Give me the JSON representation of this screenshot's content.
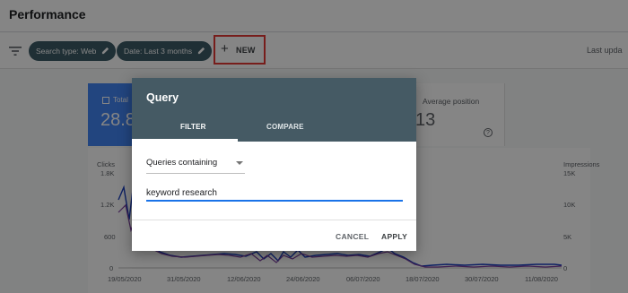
{
  "header": {
    "title": "Performance"
  },
  "filterbar": {
    "filter_icon": "filter-list-icon",
    "chips": [
      {
        "label": "Search type: Web",
        "icon": "pencil-icon"
      },
      {
        "label": "Date: Last 3 months",
        "icon": "pencil-icon"
      }
    ],
    "new_button": {
      "icon": "plus-icon",
      "label": "NEW"
    },
    "last_update": "Last upda"
  },
  "cards": {
    "total": {
      "label": "Total",
      "value": "28.8"
    },
    "position": {
      "label": "Average position",
      "value": "13",
      "help_icon": "help-icon"
    }
  },
  "chart": {
    "left_axis_title": "Clicks",
    "right_axis_title": "Impressions",
    "left_ticks": [
      "1.8K",
      "1.2K",
      "600",
      "0"
    ],
    "right_ticks": [
      "15K",
      "10K",
      "5K",
      "0"
    ],
    "x_ticks": [
      "19/05/2020",
      "31/05/2020",
      "12/06/2020",
      "24/06/2020",
      "06/07/2020",
      "18/07/2020",
      "30/07/2020",
      "11/08/2020"
    ],
    "colors": {
      "clicks": "#1a3fbf",
      "impressions": "#7b3fa0"
    }
  },
  "dialog": {
    "title": "Query",
    "tabs": [
      {
        "label": "FILTER"
      },
      {
        "label": "COMPARE"
      }
    ],
    "select": {
      "value": "Queries containing"
    },
    "input": {
      "value": "keyword research"
    },
    "buttons": {
      "cancel": "CANCEL",
      "apply": "APPLY"
    }
  }
}
